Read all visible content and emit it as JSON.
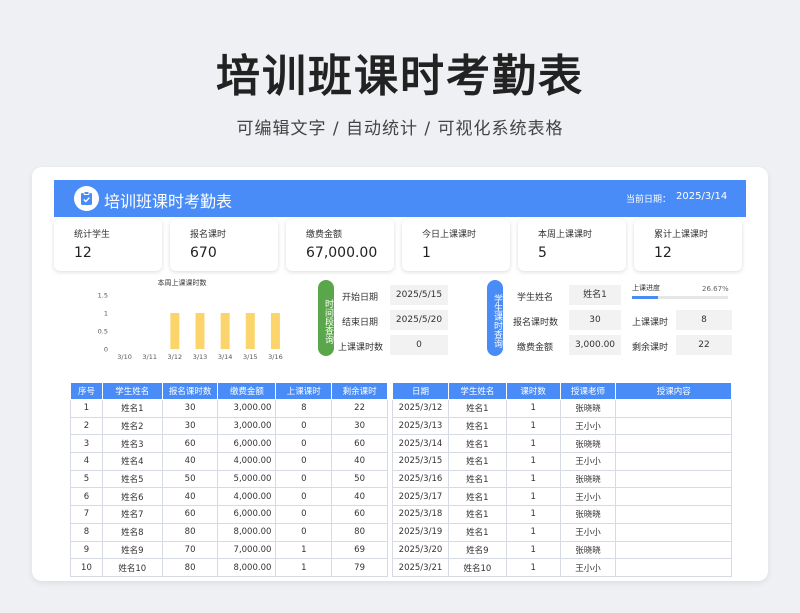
{
  "header": {
    "title": "培训班课时考勤表",
    "subtitle": "可编辑文字  /  自动统计  /  可视化系统表格"
  },
  "banner": {
    "title": "培训班课时考勤表",
    "date_label": "当前日期：",
    "date": "2025/3/14",
    "color": "#4a8cf7"
  },
  "stats": [
    {
      "label": "统计学生",
      "value": "12"
    },
    {
      "label": "报名课时",
      "value": "670"
    },
    {
      "label": "缴费金额",
      "value": "67,000.00"
    },
    {
      "label": "今日上课课时",
      "value": "1"
    },
    {
      "label": "本周上课课时",
      "value": "5"
    },
    {
      "label": "累计上课课时",
      "value": "12"
    }
  ],
  "chart_data": {
    "type": "bar",
    "title": "本周上课课时数",
    "categories": [
      "3/10",
      "3/11",
      "3/12",
      "3/13",
      "3/14",
      "3/15",
      "3/16"
    ],
    "values": [
      0,
      0,
      1,
      1,
      1,
      1,
      1
    ],
    "ylim": [
      0,
      1.5
    ],
    "yticks": [
      "0",
      "0.5",
      "1",
      "1.5"
    ],
    "bar_color": "#fbd46b",
    "grid": false
  },
  "time_query": {
    "pill_label": "时间段查询",
    "pill_color": "#5aa64a",
    "start_label": "开始日期",
    "start_value": "2025/5/15",
    "end_label": "结束日期",
    "end_value": "2025/5/20",
    "count_label": "上课课时数",
    "count_value": "0"
  },
  "student_query": {
    "pill_label": "学生课时查询",
    "pill_color": "#4a8cf7",
    "name_label": "学生姓名",
    "name_value": "姓名1",
    "hours_label": "报名课时数",
    "hours_value": "30",
    "fee_label": "缴费金额",
    "fee_value": "3,000.00"
  },
  "progress": {
    "label": "上课进度",
    "percent_text": "26.67%",
    "fraction": 0.2667,
    "attended_label": "上课课时",
    "attended_value": "8",
    "remaining_label": "剩余课时",
    "remaining_value": "22"
  },
  "students_table": {
    "headers": [
      "序号",
      "学生姓名",
      "报名课时数",
      "缴费金额",
      "上课课时",
      "剩余课时"
    ],
    "rows": [
      [
        "1",
        "姓名1",
        "30",
        "3,000.00",
        "8",
        "22"
      ],
      [
        "2",
        "姓名2",
        "30",
        "3,000.00",
        "0",
        "30"
      ],
      [
        "3",
        "姓名3",
        "60",
        "6,000.00",
        "0",
        "60"
      ],
      [
        "4",
        "姓名4",
        "40",
        "4,000.00",
        "0",
        "40"
      ],
      [
        "5",
        "姓名5",
        "50",
        "5,000.00",
        "0",
        "50"
      ],
      [
        "6",
        "姓名6",
        "40",
        "4,000.00",
        "0",
        "40"
      ],
      [
        "7",
        "姓名7",
        "60",
        "6,000.00",
        "0",
        "60"
      ],
      [
        "8",
        "姓名8",
        "80",
        "8,000.00",
        "0",
        "80"
      ],
      [
        "9",
        "姓名9",
        "70",
        "7,000.00",
        "1",
        "69"
      ],
      [
        "10",
        "姓名10",
        "80",
        "8,000.00",
        "1",
        "79"
      ]
    ]
  },
  "records_table": {
    "headers": [
      "日期",
      "学生姓名",
      "课时数",
      "授课老师",
      "授课内容"
    ],
    "rows": [
      [
        "2025/3/12",
        "姓名1",
        "1",
        "张晓晓",
        ""
      ],
      [
        "2025/3/13",
        "姓名1",
        "1",
        "王小小",
        ""
      ],
      [
        "2025/3/14",
        "姓名1",
        "1",
        "张晓晓",
        ""
      ],
      [
        "2025/3/15",
        "姓名1",
        "1",
        "王小小",
        ""
      ],
      [
        "2025/3/16",
        "姓名1",
        "1",
        "张晓晓",
        ""
      ],
      [
        "2025/3/17",
        "姓名1",
        "1",
        "王小小",
        ""
      ],
      [
        "2025/3/18",
        "姓名1",
        "1",
        "张晓晓",
        ""
      ],
      [
        "2025/3/19",
        "姓名1",
        "1",
        "王小小",
        ""
      ],
      [
        "2025/3/20",
        "姓名9",
        "1",
        "张晓晓",
        ""
      ],
      [
        "2025/3/21",
        "姓名10",
        "1",
        "王小小",
        ""
      ]
    ]
  }
}
